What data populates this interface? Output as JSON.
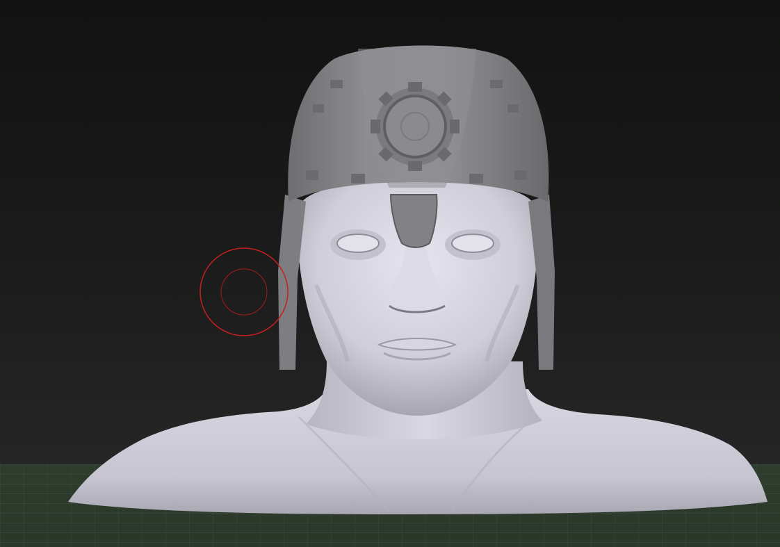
{
  "viewport": {
    "background_top_color": "#111211",
    "background_bottom_color": "#262826",
    "floor_grid_color": "#2c3a2c"
  },
  "model": {
    "description_icon": "sculpted-bust-mesh",
    "skin_color": "#d2d0db",
    "helmet_color": "#8a898c"
  },
  "brush_cursor": {
    "icon": "brush-radius-cursor",
    "color": "#c42020"
  }
}
